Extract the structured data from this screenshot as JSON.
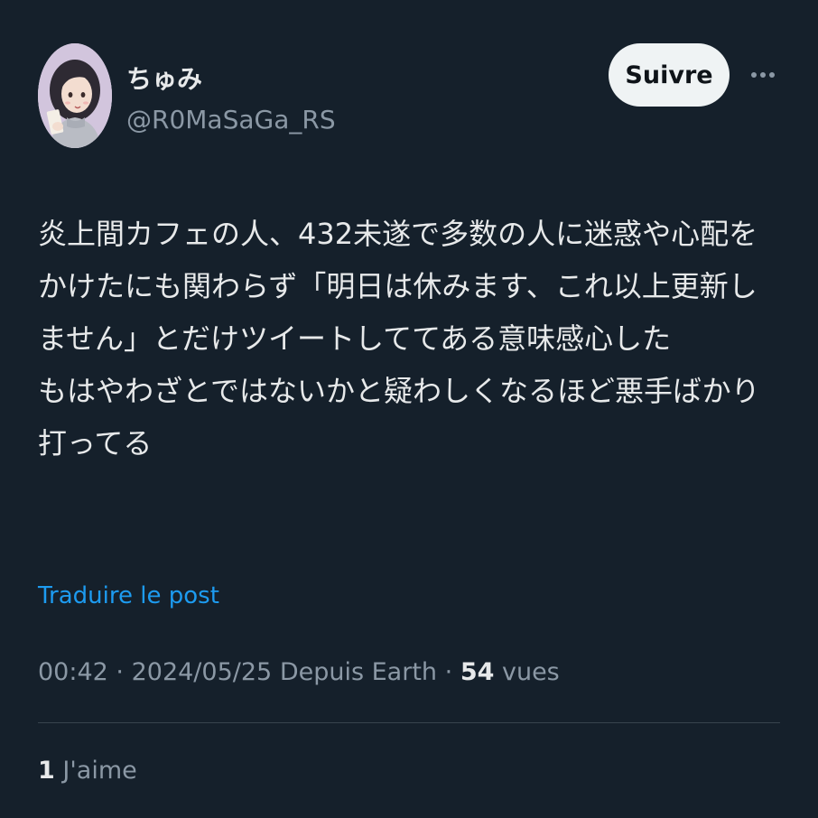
{
  "author": {
    "display_name": "ちゅみ",
    "handle": "@R0MaSaGa_RS"
  },
  "header": {
    "follow_label": "Suivre",
    "more_icon": "more-horizontal-icon"
  },
  "tweet": {
    "text": "炎上間カフェの人、432未遂で多数の人に迷惑や心配をかけたにも関わらず「明日は休みます、これ以上更新しません」とだけツイートしててある意味感心した\nもはやわざとではないかと疑わしくなるほど悪手ばかり打ってる",
    "translate_label": "Traduire le post"
  },
  "meta": {
    "time": "00:42",
    "separator": "·",
    "date": "2024/05/25",
    "source": "Depuis Earth",
    "views_count": "54",
    "views_label": "vues"
  },
  "engagement": {
    "likes_count": "1",
    "likes_label": "J'aime"
  },
  "colors": {
    "background": "#15202b",
    "text": "#e7e9ea",
    "secondary": "#8b98a5",
    "link": "#1d9bf0",
    "follow_bg": "#eff3f4"
  }
}
